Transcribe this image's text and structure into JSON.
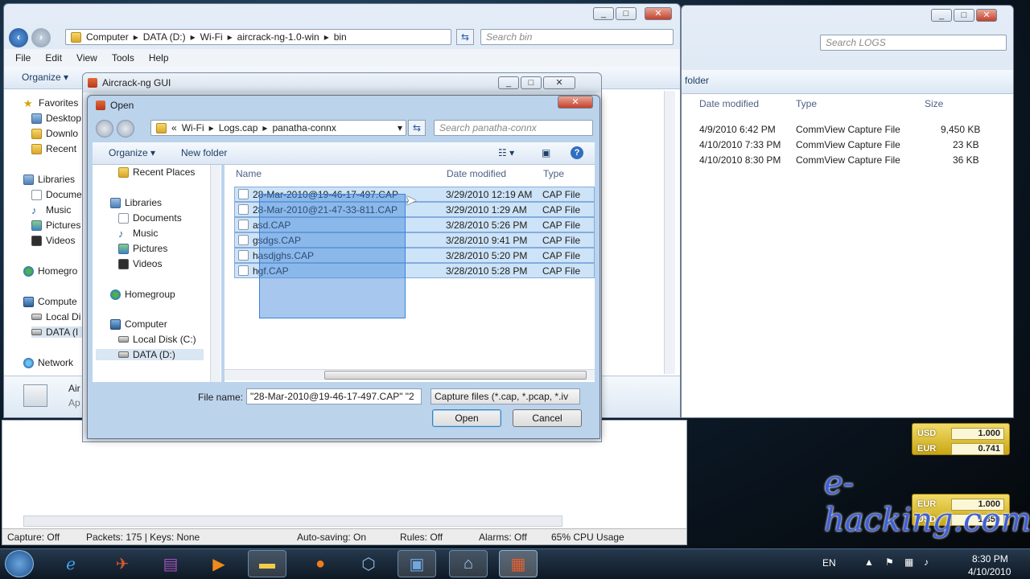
{
  "explorer_back": {
    "breadcrumb": [
      "Computer",
      "DATA (D:)",
      "Wi-Fi",
      "aircrack-ng-1.0-win",
      "bin"
    ],
    "search_placeholder": "Search bin",
    "menu": [
      "File",
      "Edit",
      "View",
      "Tools",
      "Help"
    ],
    "organize": "Organize",
    "nav": {
      "favorites": "Favorites",
      "desktop": "Desktop",
      "downloads": "Downlo",
      "recent": "Recent",
      "libraries": "Libraries",
      "documents": "Docume",
      "music": "Music",
      "pictures": "Pictures",
      "videos": "Videos",
      "homegroup": "Homegro",
      "computer": "Compute",
      "local_disk": "Local Di",
      "data_disk": "DATA (I",
      "network": "Network"
    },
    "details": {
      "name": "Air",
      "type": "Ap"
    }
  },
  "explorer_right": {
    "search_placeholder": "Search LOGS",
    "folder_label": "folder",
    "columns": [
      "Date modified",
      "Type",
      "Size"
    ],
    "rows": [
      {
        "date": "4/9/2010 6:42 PM",
        "type": "CommView Capture File",
        "size": "9,450 KB"
      },
      {
        "date": "4/10/2010 7:33 PM",
        "type": "CommView Capture File",
        "size": "23 KB"
      },
      {
        "date": "4/10/2010 8:30 PM",
        "type": "CommView Capture File",
        "size": "36 KB"
      }
    ]
  },
  "aircrack_window": {
    "title": "Aircrack-ng GUI"
  },
  "open_dialog": {
    "title": "Open",
    "breadcrumb_prefix": "«",
    "breadcrumb": [
      "Wi-Fi",
      "Logs.cap",
      "panatha-connx"
    ],
    "search_placeholder": "Search panatha-connx",
    "organize": "Organize",
    "new_folder": "New folder",
    "nav": {
      "recent_places": "Recent Places",
      "libraries": "Libraries",
      "documents": "Documents",
      "music": "Music",
      "pictures": "Pictures",
      "videos": "Videos",
      "homegroup": "Homegroup",
      "computer": "Computer",
      "local_disk": "Local Disk (C:)",
      "data_disk": "DATA (D:)"
    },
    "columns": {
      "name": "Name",
      "date": "Date modified",
      "type": "Type"
    },
    "files": [
      {
        "name": "28-Mar-2010@19-46-17-497.CAP",
        "date": "3/29/2010 12:19 AM",
        "type": "CAP File"
      },
      {
        "name": "28-Mar-2010@21-47-33-811.CAP",
        "date": "3/29/2010 1:29 AM",
        "type": "CAP File"
      },
      {
        "name": "asd.CAP",
        "date": "3/28/2010 5:26 PM",
        "type": "CAP File"
      },
      {
        "name": "gsdgs.CAP",
        "date": "3/28/2010 9:41 PM",
        "type": "CAP File"
      },
      {
        "name": "hasdjghs.CAP",
        "date": "3/28/2010 5:20 PM",
        "type": "CAP File"
      },
      {
        "name": "hgf.CAP",
        "date": "3/28/2010 5:28 PM",
        "type": "CAP File"
      }
    ],
    "filename_label": "File name:",
    "filename_value": "\"28-Mar-2010@19-46-17-497.CAP\" \"2",
    "filter_value": "Capture files (*.cap, *.pcap, *.iv",
    "open_button": "Open",
    "cancel_button": "Cancel"
  },
  "commview_status": {
    "capture": "Capture: Off",
    "packets": "Packets: 175 | Keys: None",
    "autosave": "Auto-saving: On",
    "rules": "Rules: Off",
    "alarms": "Alarms: Off",
    "cpu": "65% CPU Usage"
  },
  "currency_gadget": [
    {
      "currency": "USD",
      "value": "1.000"
    },
    {
      "currency": "EUR",
      "value": "0.741"
    },
    {
      "currency": "EUR",
      "value": "1.000"
    },
    {
      "currency": "USD",
      "value": "1.350"
    }
  ],
  "watermark": "e-hacking.com",
  "taskbar": {
    "language": "EN",
    "time": "8:30 PM",
    "date": "4/10/2010"
  },
  "colors": {
    "selection": "#cde3f7",
    "drag_select": "#3b82d9",
    "dialog_frame": "#bcd3ec"
  }
}
